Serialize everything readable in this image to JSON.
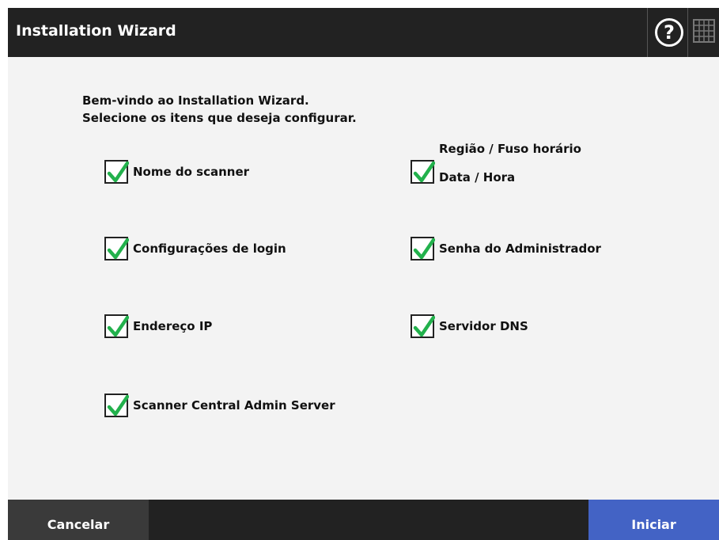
{
  "window": {
    "title": "Installation Wizard"
  },
  "header": {
    "help_icon": "question-circle-icon",
    "help_glyph": "?",
    "keyboard_icon": "keyboard-icon"
  },
  "intro": {
    "line1": "Bem-vindo ao Installation Wizard.",
    "line2": "Selecione os itens que deseja configurar."
  },
  "options": [
    {
      "label": "Nome do scanner",
      "checked": true
    },
    {
      "label": "Configurações de login",
      "checked": true
    },
    {
      "label": "Endereço IP",
      "checked": true
    },
    {
      "label": "Scanner Central Admin Server",
      "checked": true
    },
    {
      "label_line1": "Região / Fuso horário",
      "label_line2": "Data / Hora",
      "checked": true
    },
    {
      "label": "Senha do Administrador",
      "checked": true
    },
    {
      "label": "Servidor DNS",
      "checked": true
    }
  ],
  "footer": {
    "cancel_label": "Cancelar",
    "start_label": "Iniciar"
  },
  "colors": {
    "titlebar": "#222222",
    "content_bg": "#f3f3f3",
    "check_green": "#22b14c",
    "start_button": "#4363c5",
    "cancel_button": "#3a3a3a"
  }
}
